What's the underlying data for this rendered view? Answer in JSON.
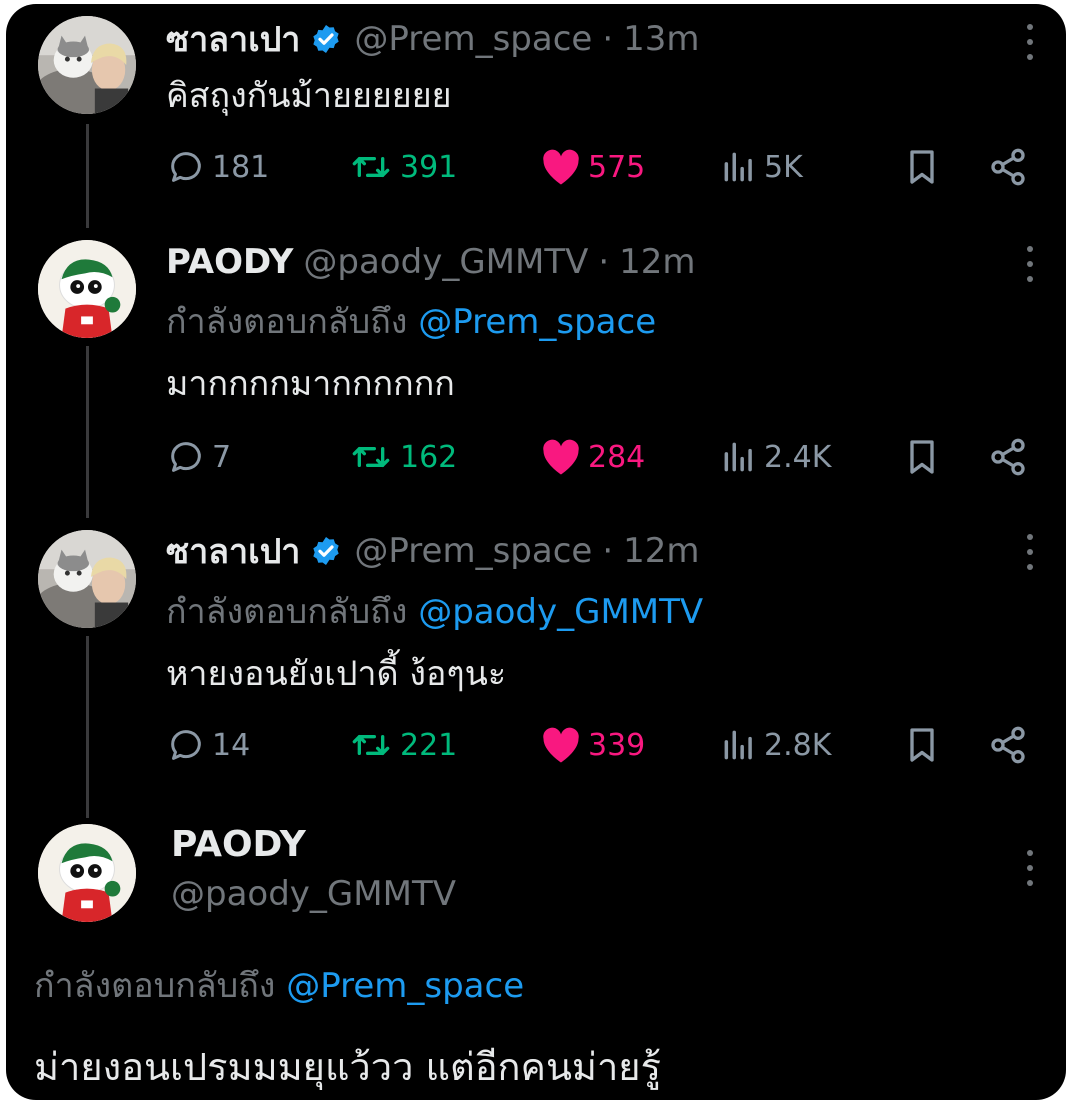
{
  "tweets": [
    {
      "name": "ซาลาเปา",
      "handle": "@Prem_space",
      "time": "13m",
      "verified": true,
      "text": "คิสถุงกันม้ายยยยยย",
      "replies": "181",
      "retweets": "391",
      "likes": "575",
      "views": "5K"
    },
    {
      "name": "PAODY",
      "handle": "@paody_GMMTV",
      "time": "12m",
      "verified": false,
      "reply_prefix": "กำลังตอบกลับถึง",
      "reply_mention": "@Prem_space",
      "text": "มากกกกมากกกกกก",
      "replies": "7",
      "retweets": "162",
      "likes": "284",
      "views": "2.4K"
    },
    {
      "name": "ซาลาเปา",
      "handle": "@Prem_space",
      "time": "12m",
      "verified": true,
      "reply_prefix": "กำลังตอบกลับถึง",
      "reply_mention": "@paody_GMMTV",
      "text": "หายงอนยังเปาดี้ ง้อๆนะ",
      "replies": "14",
      "retweets": "221",
      "likes": "339",
      "views": "2.8K"
    }
  ],
  "focused": {
    "name": "PAODY",
    "handle": "@paody_GMMTV",
    "reply_prefix": "กำลังตอบกลับถึง",
    "reply_mention": "@Prem_space",
    "text": "ม่ายงอนเปรมมมยุแว้วว แต่อีกคนม่ายรู้"
  },
  "icons": {
    "reply": "speech-bubble-icon",
    "retweet": "retweet-icon",
    "like": "heart-filled-icon",
    "views": "bar-chart-icon",
    "bookmark": "bookmark-icon",
    "share": "share-icon",
    "more": "vertical-dots-icon",
    "verified": "verified-badge-icon"
  },
  "colors": {
    "background": "#000000",
    "text": "#e7e9ea",
    "muted": "#71767b",
    "link": "#1d9bf0",
    "retweet": "#00ba7c",
    "like": "#f91880"
  }
}
